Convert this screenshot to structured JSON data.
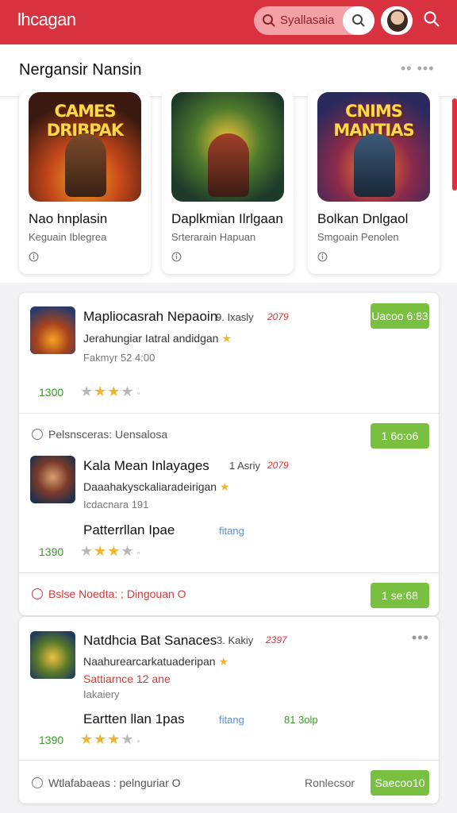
{
  "header": {
    "logo": "lhcagan",
    "search_text": "Syallasaia",
    "colors": {
      "brand": "#d8313f",
      "accent_green": "#79c040"
    },
    "icons": [
      "search-icon",
      "avatar",
      "search-icon"
    ]
  },
  "featured": {
    "title": "Nergansir Nansin",
    "more": "•• •••",
    "cards": [
      {
        "art_text": "CAMES\nDRIBPAK",
        "name": "Nao hnplasin",
        "sub": "Keguain Iblegrea"
      },
      {
        "art_text": "",
        "name": "Daplkmian Ilrlgaan",
        "sub": "Srterarain Hapuan"
      },
      {
        "art_text": "CNIMS\nMANTIAS",
        "name": "Bolkan Dnlgaol",
        "sub": "Smgoain Penolen"
      }
    ]
  },
  "items": [
    {
      "name": "Mapliocasrah Nepaoin",
      "meta": "9. Ixasly",
      "meta_red": "2079",
      "desc": "Jerahungiar Iatral andidgan",
      "sub": "Fakmyr 52 4:00",
      "count": "1300",
      "rating": 3,
      "button": "Uacoo 6:83"
    },
    {
      "notice": "Pelsnsceras: Uensalosa",
      "button_top": "1 6o:o6",
      "name": "Kala Mean Inlayages",
      "meta": "1 Asriy",
      "meta_red": "2079",
      "desc": "Daaahakysckaliaradeirigan",
      "sub": "Icdacnara 191",
      "line2": "Patterrllan Ipae",
      "tag": "fitang",
      "count": "1390",
      "rating": 3,
      "footer_notice": "Bslse Noedta: ; Dingouan O",
      "button": "1 se:68"
    },
    {
      "name": "Natdhcia Bat Sanaces",
      "meta": "3. Kakiy",
      "meta_red": "2397",
      "desc": "Naahurearcarkatuaderipan",
      "red_line": "Sattiarnce 12 ane",
      "sub": "Iakaiery",
      "line2": "Eartten llan 1pas",
      "tag": "fitang",
      "tag2": "81 3olp",
      "count": "1390",
      "rating": 3,
      "more": "•••",
      "footer_notice": "Wtlafabaeas : pelnguriar O",
      "footer_right": "Ronlecsor",
      "button": "Saecoo10"
    }
  ]
}
